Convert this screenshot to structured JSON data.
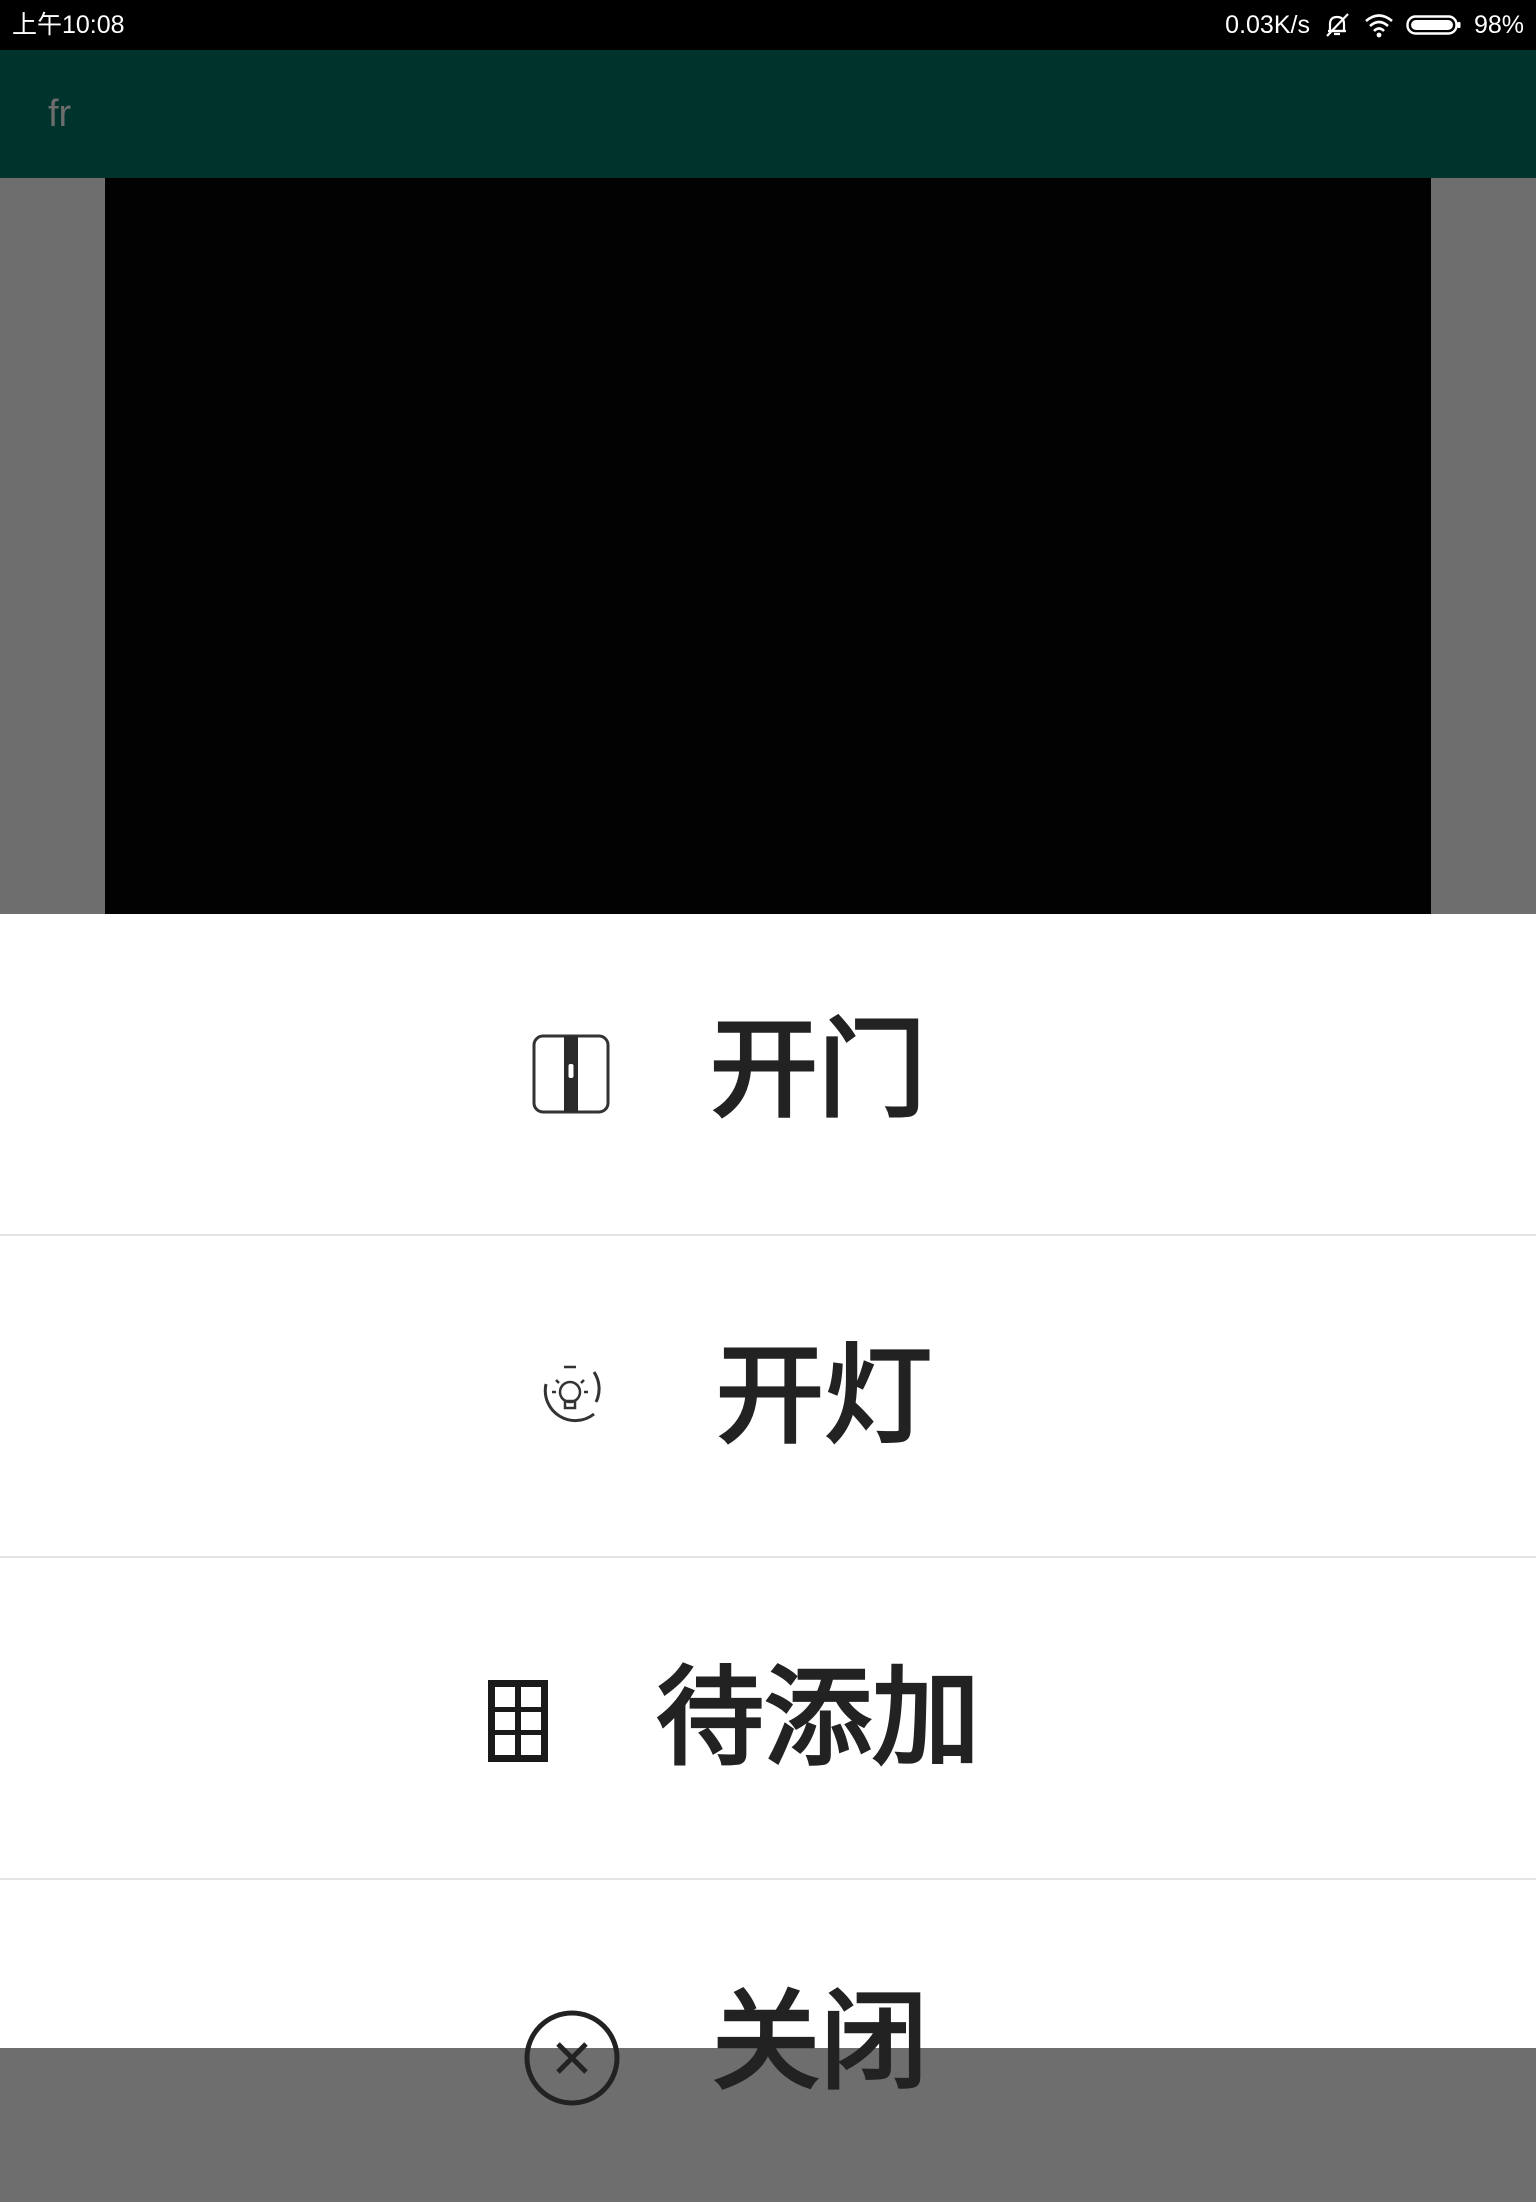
{
  "status_bar": {
    "time": "上午10:08",
    "network_speed": "0.03K/s",
    "battery": "98%",
    "icons": [
      "silent-notification-icon",
      "wifi-icon",
      "battery-icon"
    ]
  },
  "app_bar": {
    "title": "fr",
    "background_color": "#00332c"
  },
  "camera_view": {
    "background_color": "#030202"
  },
  "action_sheet": {
    "items": [
      {
        "label": "开门",
        "icon": "door-icon"
      },
      {
        "label": "开灯",
        "icon": "light-bulb-icon"
      },
      {
        "label": "待添加",
        "icon": "window-icon"
      },
      {
        "label": "关闭",
        "icon": "close-circle-icon"
      }
    ]
  }
}
